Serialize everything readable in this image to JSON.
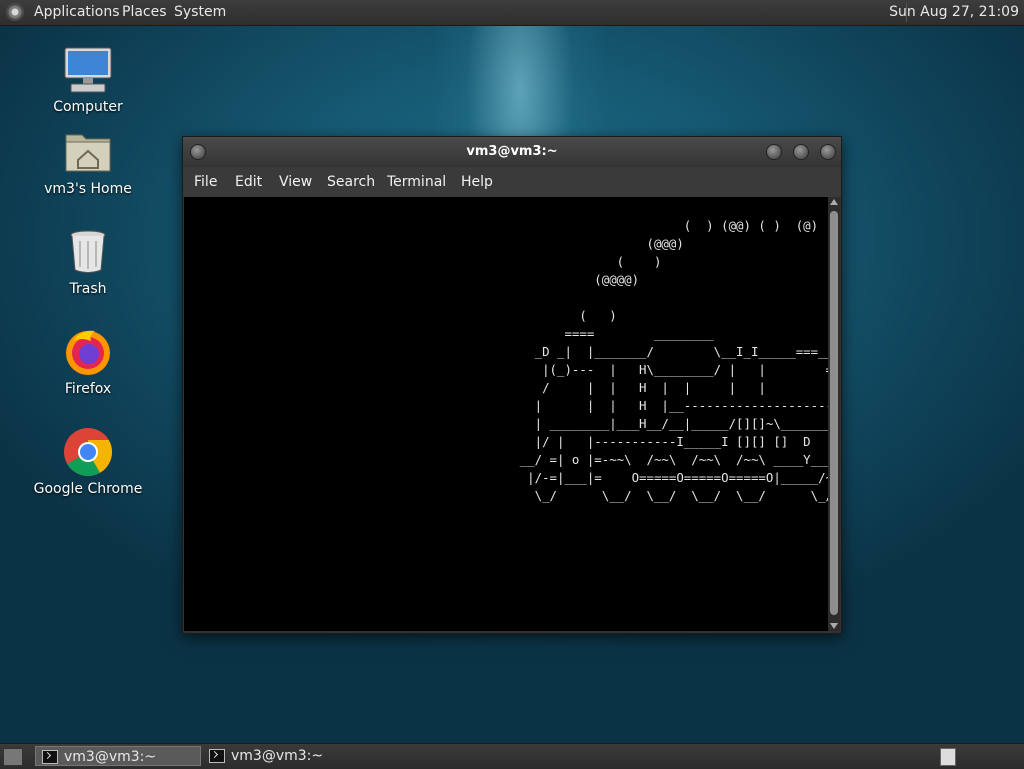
{
  "top_panel": {
    "menu": [
      "Applications",
      "Places",
      "System"
    ],
    "clock": "Sun Aug 27, 21:09"
  },
  "desktop_icons": [
    {
      "label": "Computer",
      "icon": "computer-icon"
    },
    {
      "label": "vm3's Home",
      "icon": "home-folder-icon"
    },
    {
      "label": "Trash",
      "icon": "trash-icon"
    },
    {
      "label": "Firefox",
      "icon": "firefox-icon"
    },
    {
      "label": "Google Chrome",
      "icon": "chrome-icon"
    }
  ],
  "terminal": {
    "title": "vm3@vm3:~",
    "menu": [
      "File",
      "Edit",
      "View",
      "Search",
      "Terminal",
      "Help"
    ],
    "output": "                                                                   (  ) (@@) ( )  (@)  ()    @@    O     @@\n                                                              (@@@)\n                                                          (    )\n                                                       (@@@@)\n\n                                                     (   )\n                                                   ====        ________                ___________\n                                               _D _|  |_______/        \\__I_I_____===__|_________|\n                                                |(_)---  |   H\\________/ |   |        =|___ ___|   \n                                                /     |  |   H  |  |     |   |         ||_| |_||   \n                                               |      |  |   H  |__--------------------| [___] |   \n                                               | ________|___H__/__|_____/[][]~\\_______|       |   \n                                               |/ |   |-----------I_____I [][] []  D   |=======|__ \n                                             __/ =| o |=-~~\\  /~~\\  /~~\\  /~~\\ ____Y___________|__ \n                                              |/-=|___|=    O=====O=====O=====O|_____/~\\___/       \n                                               \\_/      \\__/  \\__/  \\__/  \\__/      \\_/            "
  },
  "taskbar": {
    "tasks": [
      "vm3@vm3:~",
      "vm3@vm3:~"
    ]
  }
}
